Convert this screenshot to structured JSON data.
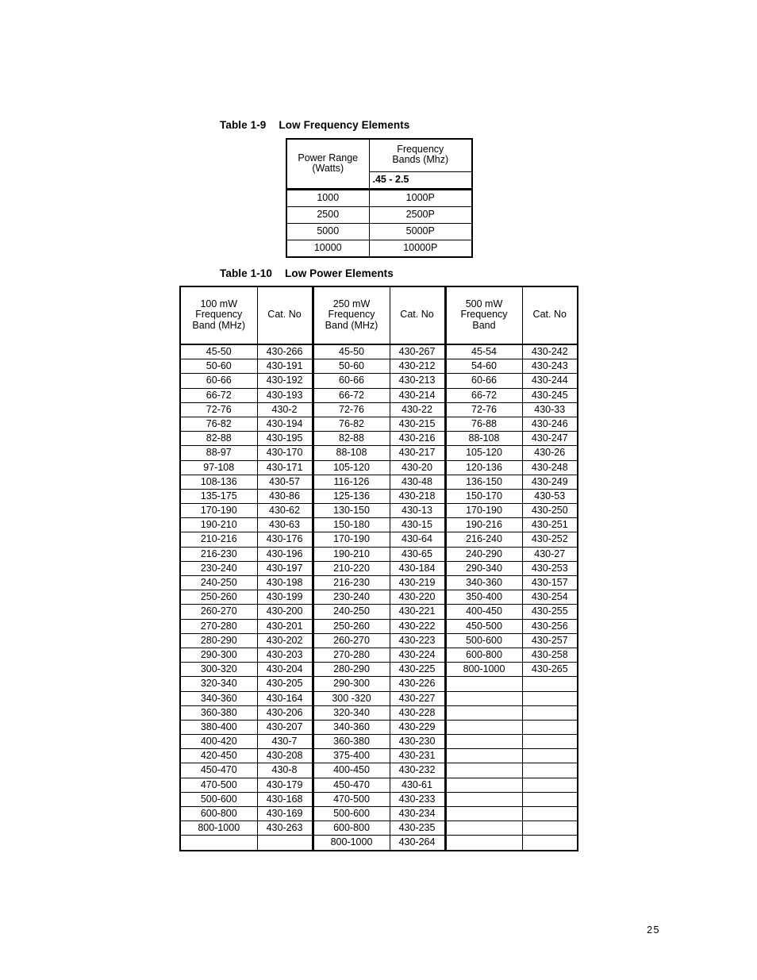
{
  "page": {
    "number": "25"
  },
  "table_1_9": {
    "caption_number": "Table 1-9",
    "caption_title": "Low Frequency Elements",
    "headers": {
      "power_range": "Power Range (Watts)",
      "power_range_line1": "Power Range",
      "power_range_line2": "(Watts)",
      "frequency_bands": "Frequency Bands (Mhz)",
      "frequency_bands_line1": "Frequency",
      "frequency_bands_line2": "Bands (Mhz)",
      "sub_band": ".45 - 2.5"
    },
    "rows": [
      {
        "power": "1000",
        "band": "1000P"
      },
      {
        "power": "2500",
        "band": "2500P"
      },
      {
        "power": "5000",
        "band": "5000P"
      },
      {
        "power": "10000",
        "band": "10000P"
      }
    ]
  },
  "table_1_10": {
    "caption_number": "Table 1-10",
    "caption_title": "Low Power Elements",
    "headers": {
      "col1_line1": "100 mW",
      "col1_line2": "Frequency",
      "col1_line3": "Band (MHz)",
      "col2": "Cat. No",
      "col3_line1": "250 mW",
      "col3_line2": "Frequency",
      "col3_line3": "Band (MHz)",
      "col4": "Cat. No",
      "col5_line1": "500 mW",
      "col5_line2": "Frequency",
      "col5_line3": "Band",
      "col6": "Cat. No"
    },
    "rows": [
      {
        "b100": "45-50",
        "c100": "430-266",
        "b250": "45-50",
        "c250": "430-267",
        "b500": "45-54",
        "c500": "430-242"
      },
      {
        "b100": "50-60",
        "c100": "430-191",
        "b250": "50-60",
        "c250": "430-212",
        "b500": "54-60",
        "c500": "430-243"
      },
      {
        "b100": "60-66",
        "c100": "430-192",
        "b250": "60-66",
        "c250": "430-213",
        "b500": "60-66",
        "c500": "430-244"
      },
      {
        "b100": "66-72",
        "c100": "430-193",
        "b250": "66-72",
        "c250": "430-214",
        "b500": "66-72",
        "c500": "430-245"
      },
      {
        "b100": "72-76",
        "c100": "430-2",
        "b250": "72-76",
        "c250": "430-22",
        "b500": "72-76",
        "c500": "430-33"
      },
      {
        "b100": "76-82",
        "c100": "430-194",
        "b250": "76-82",
        "c250": "430-215",
        "b500": "76-88",
        "c500": "430-246"
      },
      {
        "b100": "82-88",
        "c100": "430-195",
        "b250": "82-88",
        "c250": "430-216",
        "b500": "88-108",
        "c500": "430-247"
      },
      {
        "b100": "88-97",
        "c100": "430-170",
        "b250": "88-108",
        "c250": "430-217",
        "b500": "105-120",
        "c500": "430-26"
      },
      {
        "b100": "97-108",
        "c100": "430-171",
        "b250": "105-120",
        "c250": "430-20",
        "b500": "120-136",
        "c500": "430-248"
      },
      {
        "b100": "108-136",
        "c100": "430-57",
        "b250": "116-126",
        "c250": "430-48",
        "b500": "136-150",
        "c500": "430-249"
      },
      {
        "b100": "135-175",
        "c100": "430-86",
        "b250": "125-136",
        "c250": "430-218",
        "b500": "150-170",
        "c500": "430-53"
      },
      {
        "b100": "170-190",
        "c100": "430-62",
        "b250": "130-150",
        "c250": "430-13",
        "b500": "170-190",
        "c500": "430-250"
      },
      {
        "b100": "190-210",
        "c100": "430-63",
        "b250": "150-180",
        "c250": "430-15",
        "b500": "190-216",
        "c500": "430-251"
      },
      {
        "b100": "210-216",
        "c100": "430-176",
        "b250": "170-190",
        "c250": "430-64",
        "b500": "216-240",
        "c500": "430-252"
      },
      {
        "b100": "216-230",
        "c100": "430-196",
        "b250": "190-210",
        "c250": "430-65",
        "b500": "240-290",
        "c500": "430-27"
      },
      {
        "b100": "230-240",
        "c100": "430-197",
        "b250": "210-220",
        "c250": "430-184",
        "b500": "290-340",
        "c500": "430-253"
      },
      {
        "b100": "240-250",
        "c100": "430-198",
        "b250": "216-230",
        "c250": "430-219",
        "b500": "340-360",
        "c500": "430-157"
      },
      {
        "b100": "250-260",
        "c100": "430-199",
        "b250": "230-240",
        "c250": "430-220",
        "b500": "350-400",
        "c500": "430-254"
      },
      {
        "b100": "260-270",
        "c100": "430-200",
        "b250": "240-250",
        "c250": "430-221",
        "b500": "400-450",
        "c500": "430-255"
      },
      {
        "b100": "270-280",
        "c100": "430-201",
        "b250": "250-260",
        "c250": "430-222",
        "b500": "450-500",
        "c500": "430-256"
      },
      {
        "b100": "280-290",
        "c100": "430-202",
        "b250": "260-270",
        "c250": "430-223",
        "b500": "500-600",
        "c500": "430-257"
      },
      {
        "b100": "290-300",
        "c100": "430-203",
        "b250": "270-280",
        "c250": "430-224",
        "b500": "600-800",
        "c500": "430-258"
      },
      {
        "b100": "300-320",
        "c100": "430-204",
        "b250": "280-290",
        "c250": "430-225",
        "b500": "800-1000",
        "c500": "430-265"
      },
      {
        "b100": "320-340",
        "c100": "430-205",
        "b250": "290-300",
        "c250": "430-226",
        "b500": "",
        "c500": ""
      },
      {
        "b100": "340-360",
        "c100": "430-164",
        "b250": "300 -320",
        "c250": "430-227",
        "b500": "",
        "c500": ""
      },
      {
        "b100": "360-380",
        "c100": "430-206",
        "b250": "320-340",
        "c250": "430-228",
        "b500": "",
        "c500": ""
      },
      {
        "b100": "380-400",
        "c100": "430-207",
        "b250": "340-360",
        "c250": "430-229",
        "b500": "",
        "c500": ""
      },
      {
        "b100": "400-420",
        "c100": "430-7",
        "b250": "360-380",
        "c250": "430-230",
        "b500": "",
        "c500": ""
      },
      {
        "b100": "420-450",
        "c100": "430-208",
        "b250": "375-400",
        "c250": "430-231",
        "b500": "",
        "c500": ""
      },
      {
        "b100": "450-470",
        "c100": "430-8",
        "b250": "400-450",
        "c250": "430-232",
        "b500": "",
        "c500": ""
      },
      {
        "b100": "470-500",
        "c100": "430-179",
        "b250": "450-470",
        "c250": "430-61",
        "b500": "",
        "c500": ""
      },
      {
        "b100": "500-600",
        "c100": "430-168",
        "b250": "470-500",
        "c250": "430-233",
        "b500": "",
        "c500": ""
      },
      {
        "b100": "600-800",
        "c100": "430-169",
        "b250": "500-600",
        "c250": "430-234",
        "b500": "",
        "c500": ""
      },
      {
        "b100": "800-1000",
        "c100": "430-263",
        "b250": "600-800",
        "c250": "430-235",
        "b500": "",
        "c500": ""
      },
      {
        "b100": "",
        "c100": "",
        "b250": "800-1000",
        "c250": "430-264",
        "b500": "",
        "c500": ""
      }
    ]
  }
}
